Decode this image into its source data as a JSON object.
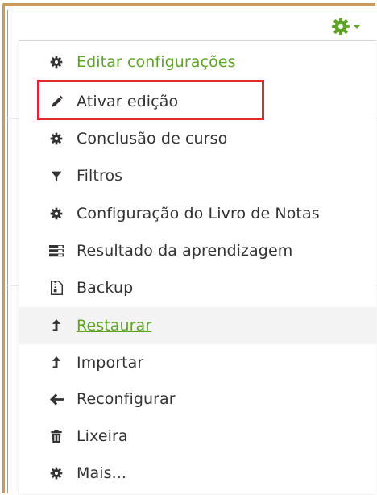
{
  "menu": {
    "trigger_icon": "gear-icon",
    "colors": {
      "accent": "#5fa427",
      "highlight": "#e2262c",
      "frame": "#c99a5b"
    },
    "items": [
      {
        "label": "Editar configurações",
        "icon": "gear-icon"
      },
      {
        "label": "Ativar edição",
        "icon": "pencil-icon"
      },
      {
        "label": "Conclusão de curso",
        "icon": "gear-icon"
      },
      {
        "label": "Filtros",
        "icon": "filter-icon"
      },
      {
        "label": "Configuração do Livro de Notas",
        "icon": "gear-icon"
      },
      {
        "label": "Resultado da aprendizagem",
        "icon": "list-icon"
      },
      {
        "label": "Backup",
        "icon": "file-archive-icon"
      },
      {
        "label": "Restaurar",
        "icon": "upload-arrow-icon"
      },
      {
        "label": "Importar",
        "icon": "upload-arrow-icon"
      },
      {
        "label": "Reconfigurar",
        "icon": "arrow-left-icon"
      },
      {
        "label": "Lixeira",
        "icon": "trash-icon"
      },
      {
        "label": "Mais...",
        "icon": "gear-icon"
      }
    ]
  }
}
